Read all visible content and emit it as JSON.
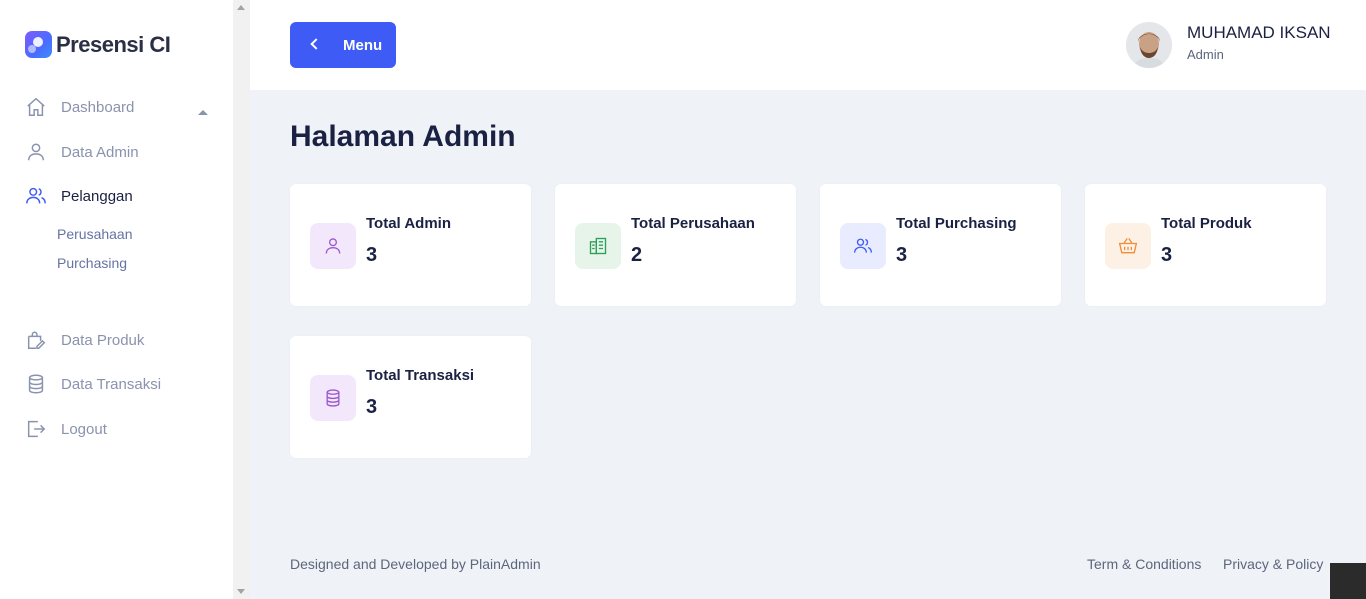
{
  "brand": {
    "name": "Presensi CI"
  },
  "sidebar": {
    "items": [
      {
        "label": "Dashboard",
        "icon": "home-icon"
      },
      {
        "label": "Data Admin",
        "icon": "user-icon"
      },
      {
        "label": "Pelanggan",
        "icon": "users-icon"
      },
      {
        "label": "Data Produk",
        "icon": "shopping-bag-icon"
      },
      {
        "label": "Data Transaksi",
        "icon": "database-icon"
      },
      {
        "label": "Logout",
        "icon": "logout-icon"
      }
    ],
    "sub_items": [
      "Perusahaan",
      "Purchasing"
    ]
  },
  "header": {
    "menu_label": "Menu",
    "user_name": "MUHAMAD IKSAN",
    "user_role": "Admin"
  },
  "main": {
    "title": "Halaman Admin",
    "cards": [
      {
        "title": "Total Admin",
        "value": "3",
        "icon": "user-icon",
        "icon_color": "#9b59d0",
        "icon_bg": "#f3e8fb"
      },
      {
        "title": "Total Perusahaan",
        "value": "2",
        "icon": "building-icon",
        "icon_color": "#2e9e5b",
        "icon_bg": "#e6f4ea"
      },
      {
        "title": "Total Purchasing",
        "value": "3",
        "icon": "users-icon",
        "icon_color": "#3e5bf6",
        "icon_bg": "#e8ecfe"
      },
      {
        "title": "Total Produk",
        "value": "3",
        "icon": "basket-icon",
        "icon_color": "#f08c3a",
        "icon_bg": "#fdf0e5"
      },
      {
        "title": "Total Transaksi",
        "value": "3",
        "icon": "database-icon",
        "icon_color": "#9b59d0",
        "icon_bg": "#f3e8fb"
      }
    ]
  },
  "footer": {
    "credit": "Designed and Developed by PlainAdmin",
    "links": [
      "Term & Conditions",
      "Privacy & Policy"
    ]
  }
}
